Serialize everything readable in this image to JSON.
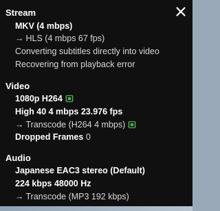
{
  "close": {
    "label": "close"
  },
  "stream": {
    "title": "Stream",
    "container": "MKV (4 mbps)",
    "output": "HLS (4 mbps 67 fps)",
    "arrow": "→",
    "subtitles_note": "Converting subtitles directly into video",
    "recovery_note": "Recovering from playback error"
  },
  "video": {
    "title": "Video",
    "resolution": "1080p H264",
    "profile": "High 40 4 mbps 23.976 fps",
    "arrow": "→",
    "transcode": "Transcode (H264 4 mbps)",
    "dropped_frames_label": "Dropped Frames",
    "dropped_frames_value": "0",
    "hw_icon_color": "#4caf50"
  },
  "audio": {
    "title": "Audio",
    "track": "Japanese EAC3 stereo (Default)",
    "bitrate": "224 kbps 48000 Hz",
    "arrow": "→",
    "transcode": "Transcode (MP3 192 kbps)"
  }
}
